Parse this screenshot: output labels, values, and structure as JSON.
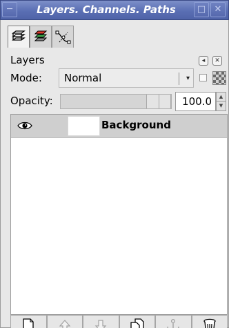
{
  "window": {
    "title": "Layers. Channels. Paths"
  },
  "tabs": [
    {
      "name": "layers-tab",
      "icon": "layers-icon",
      "active": true
    },
    {
      "name": "channels-tab",
      "icon": "channels-icon",
      "active": false
    },
    {
      "name": "paths-tab",
      "icon": "paths-icon",
      "active": false
    }
  ],
  "panel": {
    "title": "Layers",
    "mode_label": "Mode:",
    "mode_value": "Normal",
    "opacity_label": "Opacity:",
    "opacity_value": "100.0",
    "opacity_fraction": 1.0,
    "keep_transparency": false
  },
  "layers": [
    {
      "name": "Background",
      "visible": true,
      "selected": true
    }
  ],
  "bottom_buttons": [
    {
      "name": "new-layer-button",
      "icon": "new-document-icon",
      "enabled": true
    },
    {
      "name": "raise-layer-button",
      "icon": "arrow-up-icon",
      "enabled": false
    },
    {
      "name": "lower-layer-button",
      "icon": "arrow-down-icon",
      "enabled": false
    },
    {
      "name": "duplicate-layer-button",
      "icon": "duplicate-icon",
      "enabled": true
    },
    {
      "name": "anchor-layer-button",
      "icon": "anchor-icon",
      "enabled": false
    },
    {
      "name": "delete-layer-button",
      "icon": "trash-icon",
      "enabled": true
    }
  ],
  "colors": {
    "titlebar": "#5a6fb4",
    "selected_row": "#cfcfcf"
  }
}
